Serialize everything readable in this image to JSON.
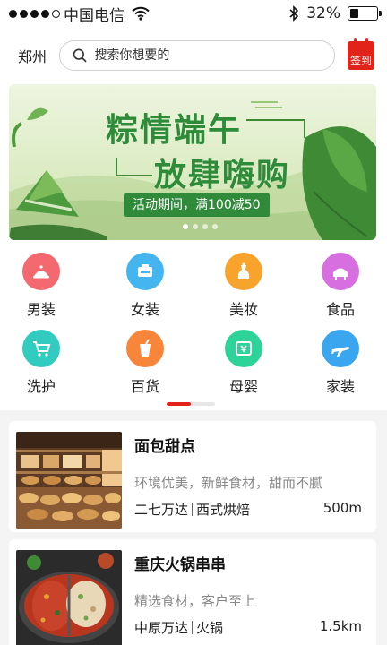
{
  "status_bar": {
    "carrier": "中国电信",
    "battery": "32%",
    "battery_level": 0.32
  },
  "header": {
    "city": "郑州",
    "search_placeholder": "搜索你想要的",
    "checkin_label": "签到"
  },
  "banner": {
    "title_line1": "粽情端午",
    "title_line2": "放肆嗨购",
    "promo": "活动期间，满100减50",
    "active_slide": 1,
    "slide_count": 4
  },
  "categories": [
    {
      "label": "男装",
      "icon": "suit-icon",
      "color": "#f4696f"
    },
    {
      "label": "女装",
      "icon": "dress-icon",
      "color": "#45b5f0"
    },
    {
      "label": "美妆",
      "icon": "lipstick-icon",
      "color": "#f8a32c"
    },
    {
      "label": "食品",
      "icon": "food-icon",
      "color": "#d86fe0"
    },
    {
      "label": "洗护",
      "icon": "cart-icon",
      "color": "#32cbbf"
    },
    {
      "label": "百货",
      "icon": "cup-icon",
      "color": "#f8863a"
    },
    {
      "label": "母婴",
      "icon": "baby-icon",
      "color": "#2ed39a"
    },
    {
      "label": "家装",
      "icon": "plane-icon",
      "color": "#3aa6f0"
    }
  ],
  "shops": [
    {
      "name": "面包甜点",
      "desc": "环境优美，新鲜食材，甜而不腻",
      "district": "二七万达",
      "type": "西式烘焙",
      "distance": "500m"
    },
    {
      "name": "重庆火锅串串",
      "desc": "精选食材，客户至上",
      "district": "中原万达",
      "type": "火锅",
      "distance": "1.5km"
    }
  ],
  "colors": {
    "accent": "#e2231a",
    "banner_green": "#2e8b3a"
  }
}
